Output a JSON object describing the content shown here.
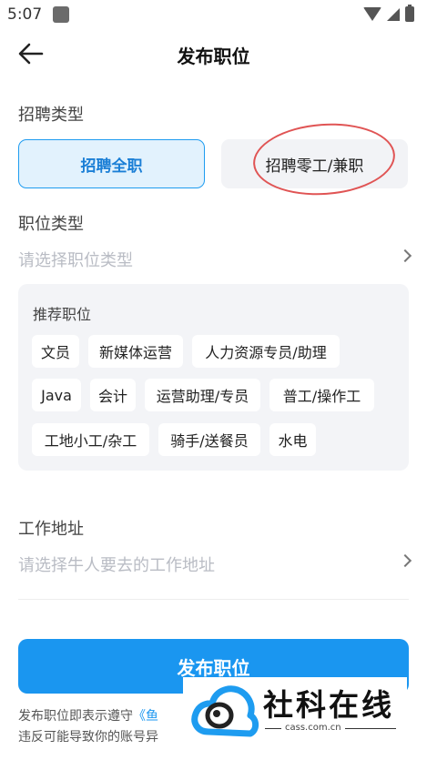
{
  "status_bar": {
    "time": "5:07"
  },
  "header": {
    "title": "发布职位"
  },
  "recruit_type": {
    "label": "招聘类型",
    "options": [
      "招聘全职",
      "招聘零工/兼职"
    ],
    "selected": "招聘全职"
  },
  "job_type": {
    "label": "职位类型",
    "placeholder": "请选择职位类型"
  },
  "recommended": {
    "title": "推荐职位",
    "tags": [
      "文员",
      "新媒体运营",
      "人力资源专员/助理",
      "Java",
      "会计",
      "运营助理/专员",
      "普工/操作工",
      "工地小工/杂工",
      "骑手/送餐员",
      "水电"
    ]
  },
  "work_address": {
    "label": "工作地址",
    "placeholder": "请选择牛人要去的工作地址"
  },
  "publish_button": {
    "label": "发布职位"
  },
  "footer": {
    "line1_prefix": "发布职位即表示遵守",
    "line1_link": "《鱼",
    "line2": "违反可能导致你的账号异"
  },
  "watermark": {
    "name": "社科在线",
    "domain": "cass.com.cn"
  },
  "colors": {
    "accent": "#1a96f0",
    "selected_bg": "#e2f2fd",
    "annotation_red": "#e05454"
  }
}
